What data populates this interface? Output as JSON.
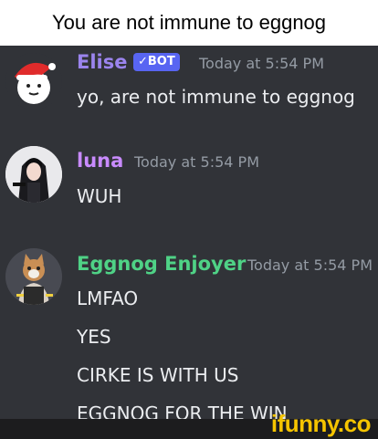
{
  "caption": "You are not immune to eggnog",
  "messages": [
    {
      "author": "Elise",
      "author_color": "#9b84ee",
      "badge": "✓BOT",
      "timestamp": "Today at 5:54 PM",
      "lines": [
        "yo, are not immune to eggnog"
      ],
      "avatar_icon": "santa-face-icon"
    },
    {
      "author": "luna",
      "author_color": "#c98bff",
      "timestamp": "Today at 5:54 PM",
      "lines": [
        "WUH"
      ],
      "avatar_icon": "anime-girl-avatar-icon"
    },
    {
      "author": "Eggnog Enjoyer",
      "author_color": "#4fd286",
      "timestamp": "Today at 5:54 PM",
      "lines": [
        "LMFAO",
        "YES",
        "CIRKE IS WITH US",
        "EGGNOG FOR THE WIN"
      ],
      "avatar_icon": "cat-avatar-icon"
    }
  ],
  "watermark": "ifunny.co"
}
